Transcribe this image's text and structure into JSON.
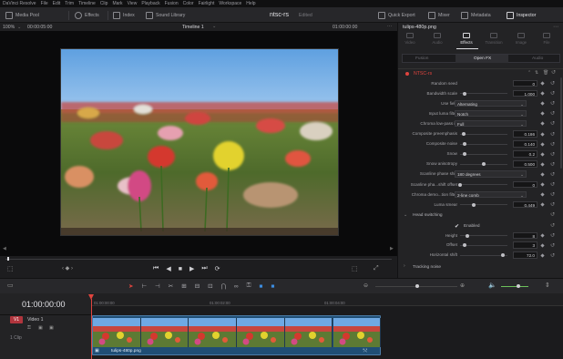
{
  "menu": [
    "DaVinci Resolve",
    "File",
    "Edit",
    "Trim",
    "Timeline",
    "Clip",
    "Mark",
    "View",
    "Playback",
    "Fusion",
    "Color",
    "Fairlight",
    "Workspace",
    "Help"
  ],
  "toolbar": {
    "media_pool": "Media Pool",
    "effects": "Effects",
    "index": "Index",
    "sound_library": "Sound Library",
    "project_title": "ntsc-rs",
    "project_status": "Edited",
    "quick_export": "Quick Export",
    "mixer": "Mixer",
    "metadata": "Metadata",
    "inspector": "Inspector"
  },
  "viewer": {
    "zoom": "100%",
    "src_timecode": "00:00:05:00",
    "timeline_name": "Timeline 1",
    "rec_timecode": "01:00:00:00"
  },
  "inspector": {
    "clip_name": "tulips-480p.png",
    "tabs": [
      "Video",
      "Audio",
      "Effects",
      "Transition",
      "Image",
      "File"
    ],
    "subtabs": [
      "Fusion",
      "Open FX",
      "Audio"
    ],
    "effect_name": "NTSC-rs",
    "params": [
      {
        "label": "Random seed",
        "kind": "num",
        "value": "0"
      },
      {
        "label": "Bandwidth scale",
        "kind": "slider",
        "value": "1.000",
        "pos": 0.1
      },
      {
        "label": "Use field",
        "kind": "dd",
        "value": "Alternating"
      },
      {
        "label": "Input luma filter",
        "kind": "dd",
        "value": "Notch"
      },
      {
        "label": "Chroma low-pass in",
        "kind": "dd",
        "value": "Full"
      },
      {
        "label": "Composite preemphasis",
        "kind": "slider",
        "value": "0.186",
        "pos": 0.08
      },
      {
        "label": "Composite noise",
        "kind": "slider",
        "value": "0.140",
        "pos": 0.1
      },
      {
        "label": "Snow",
        "kind": "slider",
        "value": "0.2",
        "pos": 0.1
      },
      {
        "label": "Snow anisotropy",
        "kind": "slider",
        "value": "0.500",
        "pos": 0.5
      },
      {
        "label": "Scanline phase shift",
        "kind": "dd",
        "value": "180 degrees"
      },
      {
        "label": "Scanline pha...shift offset",
        "kind": "slider",
        "value": "0",
        "pos": 0.0
      },
      {
        "label": "Chroma demo...tion filter",
        "kind": "dd",
        "value": "2-line comb"
      },
      {
        "label": "Luma smear",
        "kind": "slider",
        "value": "0.449",
        "pos": 0.28
      }
    ],
    "head_switching": "Head switching",
    "enabled_label": "Enabled",
    "hs_params": [
      {
        "label": "Height",
        "value": "8",
        "pos": 0.15
      },
      {
        "label": "Offset",
        "value": "3",
        "pos": 0.1
      },
      {
        "label": "Horizontal shift",
        "value": "72.0",
        "pos": 0.9
      }
    ],
    "tracking_noise": "Tracking noise"
  },
  "timeline": {
    "timecode": "01:00:00:00",
    "ruler": [
      "01:00:00:00",
      "01:00:02:00",
      "01:00:04:00"
    ],
    "track_id": "V1",
    "track_name": "Video 1",
    "clip_count": "1 Clip",
    "clip_name": "tulips-480p.png"
  },
  "colors": {
    "accent_red": "#e0443e",
    "playhead": "#e0443e",
    "clip_blue": "#1f4e75",
    "track_badge": "#b1353d"
  }
}
